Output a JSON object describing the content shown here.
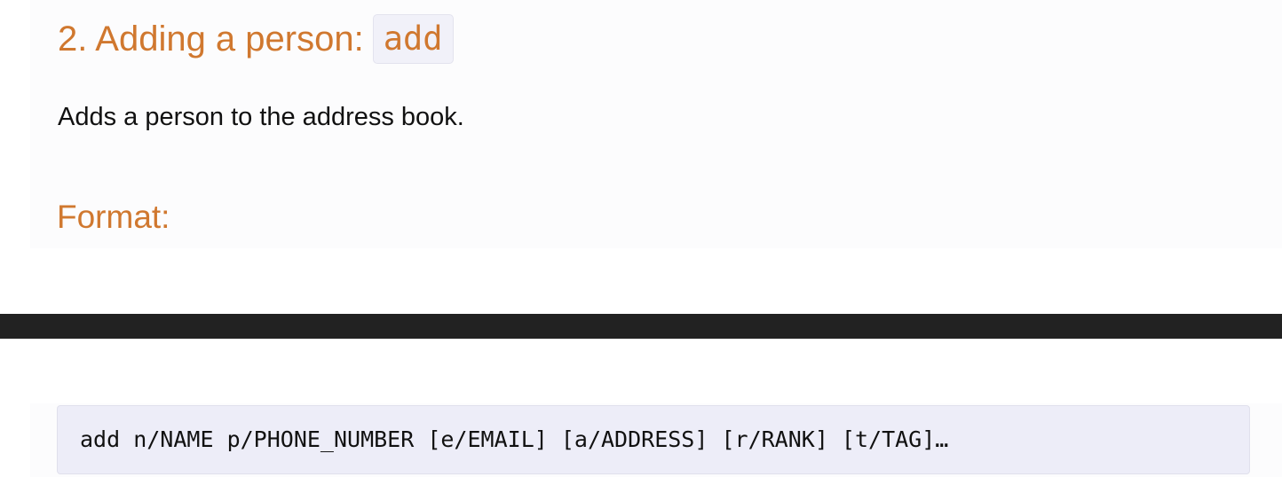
{
  "section": {
    "heading_text": "2. Adding a person:",
    "heading_code": "add",
    "description": "Adds a person to the address book.",
    "format_heading": "Format:"
  },
  "code_block": {
    "text": "add n/NAME p/PHONE_NUMBER [e/EMAIL] [a/ADDRESS] [r/RANK] [t/TAG]…"
  },
  "colors": {
    "heading_accent": "#d0782f",
    "code_background": "#ededf8",
    "divider_bar": "#222222",
    "body_text": "#111111"
  }
}
